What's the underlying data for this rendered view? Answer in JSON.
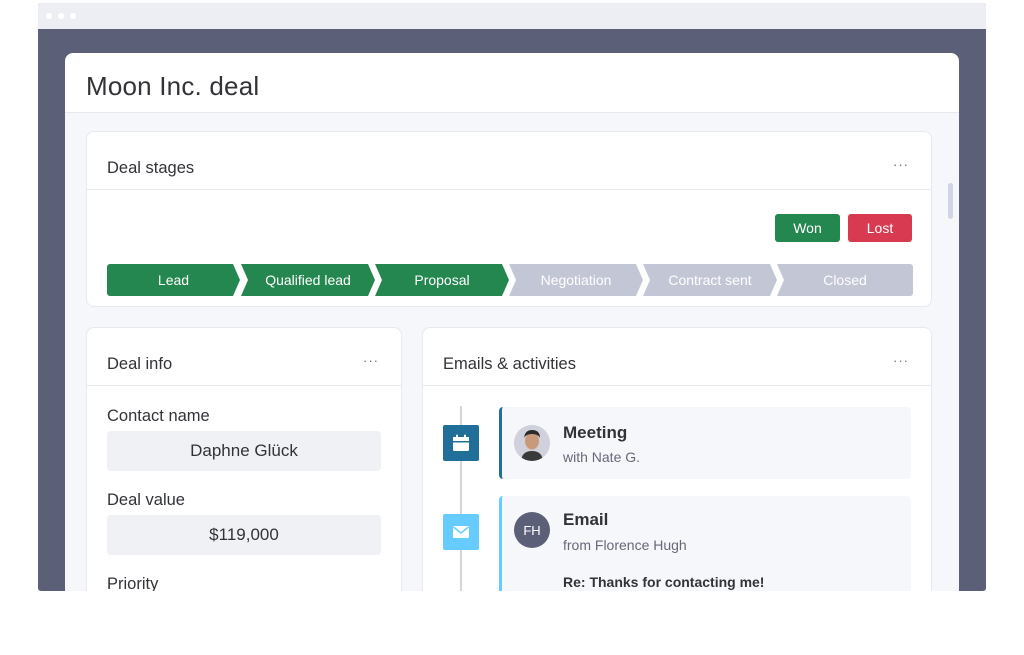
{
  "panel": {
    "title": "Moon Inc. deal"
  },
  "deal_stages": {
    "title": "Deal stages",
    "more": "···",
    "won_label": "Won",
    "lost_label": "Lost",
    "stages": [
      {
        "label": "Lead",
        "status": "done"
      },
      {
        "label": "Qualified lead",
        "status": "done"
      },
      {
        "label": "Proposal",
        "status": "done"
      },
      {
        "label": "Negotiation",
        "status": "todo"
      },
      {
        "label": "Contract sent",
        "status": "todo"
      },
      {
        "label": "Closed",
        "status": "todo"
      }
    ]
  },
  "deal_info": {
    "title": "Deal info",
    "more": "···",
    "fields": [
      {
        "label": "Contact name",
        "value": "Daphne Glück"
      },
      {
        "label": "Deal value",
        "value": "$119,000"
      },
      {
        "label": "Priority"
      }
    ]
  },
  "activities": {
    "title": "Emails & activities",
    "more": "···",
    "items": [
      {
        "type": "meeting",
        "icon": "calendar-icon",
        "title": "Meeting",
        "subtitle": "with Nate G."
      },
      {
        "type": "email",
        "icon": "mail-icon",
        "avatar_initials": "FH",
        "title": "Email",
        "subtitle": "from Florence Hugh",
        "subject": "Re: Thanks for contacting me!"
      }
    ]
  },
  "colors": {
    "done": "#258750",
    "todo": "#c3c6d4",
    "won": "#258750",
    "lost": "#d83a52",
    "meeting_accent": "#1f6f99",
    "email_accent": "#66ccff"
  }
}
